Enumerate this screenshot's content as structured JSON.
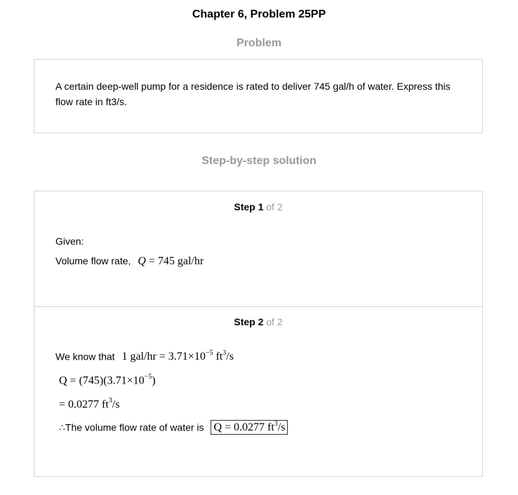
{
  "page": {
    "title": "Chapter 6, Problem 25PP"
  },
  "problem": {
    "heading": "Problem",
    "text": "A certain deep-well pump for a residence is rated to deliver 745 gal/h of water. Express this flow rate in ft3/s."
  },
  "solution": {
    "heading": "Step-by-step solution",
    "steps": [
      {
        "label": "Step 1",
        "of": "of 2",
        "given": "Given:",
        "flow_label": "Volume flow rate,",
        "flow_value": "745 gal/hr"
      },
      {
        "label": "Step 2",
        "of": "of 2",
        "know_text": "We know that",
        "conversion": "1 gal/hr = 3.71×10",
        "conversion_exp": "−5",
        "conversion_unit": " ft",
        "calc_line": "Q = (745)(3.71×10",
        "calc_exp": "−5",
        "result_line": "= 0.0277 ft",
        "therefore_text": "∴The volume flow rate of water is",
        "answer": "Q = 0.0277 ft"
      }
    ]
  }
}
